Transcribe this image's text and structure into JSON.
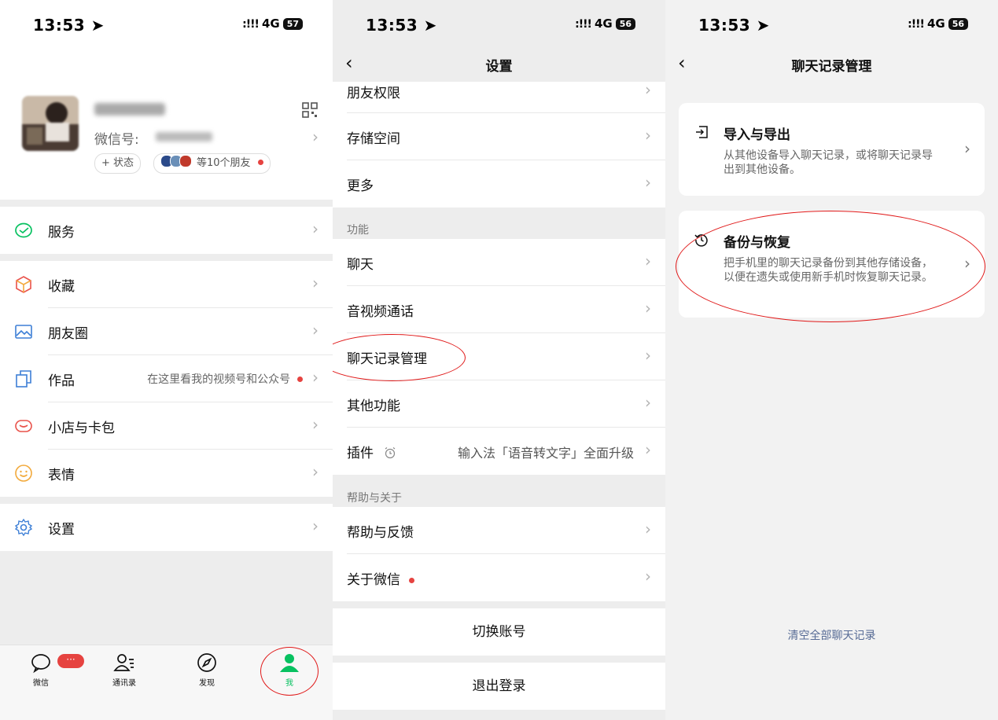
{
  "status_bars": [
    {
      "time": "13:53",
      "signal": ":!!!",
      "network": "4G",
      "battery": "57"
    },
    {
      "time": "13:53",
      "signal": ":!!!",
      "network": "4G",
      "battery": "56"
    },
    {
      "time": "13:53",
      "signal": ":!!!",
      "network": "4G",
      "battery": "56"
    }
  ],
  "me": {
    "wechat_id_label": "微信号:",
    "status_chip": "+ 状态",
    "friends_chip": "等10个朋友",
    "items": [
      {
        "label": "服务",
        "icon": "service-icon"
      },
      {
        "label": "收藏",
        "icon": "favorites-icon"
      },
      {
        "label": "朋友圈",
        "icon": "moments-icon"
      },
      {
        "label": "作品",
        "icon": "works-icon",
        "extra": "在这里看我的视频号和公众号"
      },
      {
        "label": "小店与卡包",
        "icon": "shop-icon"
      },
      {
        "label": "表情",
        "icon": "sticker-icon"
      },
      {
        "label": "设置",
        "icon": "settings-icon"
      }
    ],
    "tabs": [
      {
        "label": "微信",
        "icon": "chat-icon"
      },
      {
        "label": "通讯录",
        "icon": "contacts-icon"
      },
      {
        "label": "发现",
        "icon": "discover-icon"
      },
      {
        "label": "我",
        "icon": "me-icon"
      }
    ],
    "badge": "···"
  },
  "settings": {
    "title": "设置",
    "top_items": [
      "朋友权限",
      "存储空间",
      "更多"
    ],
    "section_function": "功能",
    "function_items": [
      "聊天",
      "音视频通话",
      "聊天记录管理",
      "其他功能"
    ],
    "plugin_label": "插件",
    "plugin_extra": "输入法「语音转文字」全面升级",
    "section_help": "帮助与关于",
    "help_items": [
      "帮助与反馈",
      "关于微信"
    ],
    "switch_account": "切换账号",
    "logout": "退出登录"
  },
  "chat_mgmt": {
    "title": "聊天记录管理",
    "cards": [
      {
        "title": "导入与导出",
        "desc": "从其他设备导入聊天记录，或将聊天记录导出到其他设备。",
        "icon": "import-export-icon"
      },
      {
        "title": "备份与恢复",
        "desc": "把手机里的聊天记录备份到其他存储设备，以便在遗失或使用新手机时恢复聊天记录。",
        "icon": "backup-restore-icon"
      }
    ],
    "clear_all": "清空全部聊天记录"
  },
  "colors": {
    "accent_green": "#07c160",
    "link_blue": "#576b95",
    "annotation_red": "#e01818",
    "badge_red": "#e64340"
  }
}
